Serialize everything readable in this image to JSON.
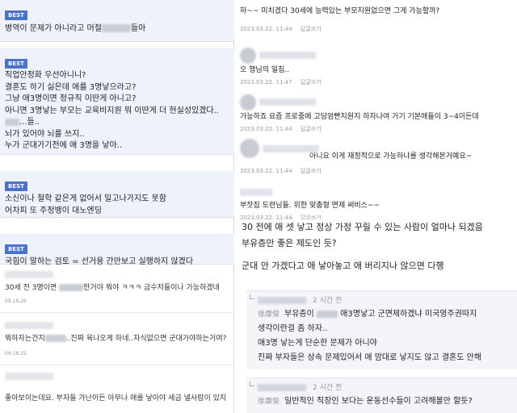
{
  "left": {
    "best_posts": [
      {
        "badge": "BEST",
        "lines": [
          "병역이 문제가 아니라고 머절",
          "들아"
        ]
      },
      {
        "badge": "BEST",
        "lines": [
          "직업안정화 우선아니니?",
          "결혼도 하기 싫은데 애를 3명낳으라고?",
          "그냥 애3명이면 정규직  이딴게 아니고?",
          "아니면 3명낳는 부모는 교육비지원 뭐 이딴게 더 현실성있겠다..",
          "...들..",
          "뇌가 있어야 뇌를 쓰지..",
          "누가 군대가기전에 애 3명을 낳아.."
        ]
      },
      {
        "badge": "BEST",
        "lines": [
          "소신이나 철학 같은게 없어서 밀고나가지도 못함",
          "어차피 또 주정뱅이 대노엔딩"
        ]
      },
      {
        "badge": "BEST",
        "lines": [
          "국힘이 말하는 검토 = 선거용 간만보고 실행하지 않겠다"
        ]
      }
    ],
    "comments": [
      {
        "text_a": "30세 전 3명이면 ",
        "text_b": "란거야 뭐야 ㅋㅋㅋ 금수저들이나 가능하겠네",
        "time": "09.18.26"
      },
      {
        "text_a": "뭐하자는건지",
        "text_b": "..진짜 육나오게 하네..자식없으면 군대가야하는거여?",
        "time": "09.18.25"
      },
      {
        "text_a": "좋아보이는데요. 부자들 가난이든 아무나 애를 낳아야 세금 낼사람이 있지",
        "text_b": "",
        "time": ""
      }
    ]
  },
  "right": {
    "comments": [
      {
        "text": "하~~ 미치겠다 30세에 능력있는 부모지원없으면 그게 가능할까?",
        "date": "2023.03.22. 11:44",
        "reply": "답글쓰기"
      },
      {
        "text": "오 행님의 일침..",
        "date": "2023.03.22. 11:47",
        "reply": "답글쓰기"
      },
      {
        "text": "가능하죠 요즘 프로중에 고딩엄빤지원지 하자나여 거기 기본애들이 3~4이든데",
        "date": "2023.03.22. 11:44",
        "reply": "답글쓰기"
      },
      {
        "text": "아니요 이게 재정적으로 가능하냐를 생각해본거예요~",
        "date": "2023.03.22. 11:44",
        "reply": "답글쓰기"
      },
      {
        "text": "부잣집 도련님들. 위한 맞춤형 면제 써비스~~",
        "date": "2023.03.22. 11:44",
        "reply": "답글쓰기"
      }
    ],
    "big_lines": [
      "30 전에 애 셋 낳고 정상 가정 꾸릴 수 있는 사람이 얼마나 되겠음",
      "부유층만 좋은 제도인 듯?",
      "",
      "군대 안 가겠다고 애 낳아놓고 애 버리지나 않으면 다행"
    ],
    "replies": [
      {
        "time": "2 시간 전",
        "author": "徐康俊",
        "lines": [
          {
            "a": "부유층이 ",
            "b": " 애3명낳고 군면제하겠냐 미국영주권따지"
          },
          {
            "a": "생각이란걸 좀 하자..",
            "b": ""
          },
          {
            "a": "애3명 낳는게 단순한 문제가 아니야",
            "b": ""
          },
          {
            "a": "진짜 부자들은 상속 문제있어서 애 맘대로 낳지도 않고 결혼도 안해",
            "b": ""
          }
        ]
      },
      {
        "time": "2 시간 전",
        "author": "徐康俊",
        "lines": [
          {
            "a": "일반적인 직장인 보다는 운동선수들이 고려해볼만 할듯?",
            "b": ""
          }
        ]
      }
    ]
  }
}
